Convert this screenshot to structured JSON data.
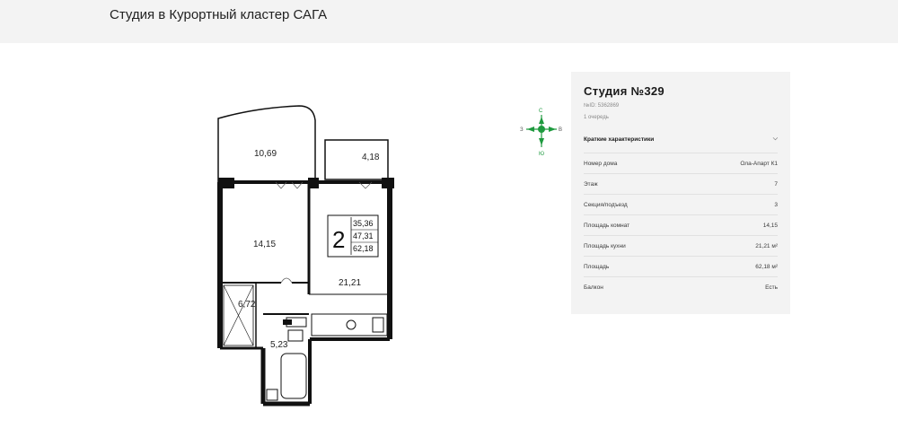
{
  "header": {
    "title": "Студия в Курортный кластер САГА"
  },
  "plan": {
    "rooms": {
      "r1": "10,69",
      "r2": "4,18",
      "r3": "14,15",
      "r4": "21,21",
      "r5": "6,72",
      "r6": "5,23"
    },
    "badge": {
      "rooms_count": "2",
      "a1": "35,36",
      "a2": "47,31",
      "a3": "62,18"
    }
  },
  "compass": {
    "n": "С",
    "s": "Ю",
    "w": "З",
    "e": "В"
  },
  "card": {
    "title": "Студия №329",
    "id": "№ID: 5362869",
    "queue": "1 очередь",
    "section_title": "Краткие характеристики",
    "rows": [
      {
        "label": "Номер дома",
        "value": "Ола-Апарт К1"
      },
      {
        "label": "Этаж",
        "value": "7"
      },
      {
        "label": "Секция/подъезд",
        "value": "3"
      },
      {
        "label": "Площадь комнат",
        "value": "14,15"
      },
      {
        "label": "Площадь кухни",
        "value": "21,21 м²"
      },
      {
        "label": "Площадь",
        "value": "62,18 м²"
      },
      {
        "label": "Балкон",
        "value": "Есть"
      }
    ]
  },
  "colors": {
    "accent": "#1f9a3f",
    "panel": "#f3f3f3"
  }
}
